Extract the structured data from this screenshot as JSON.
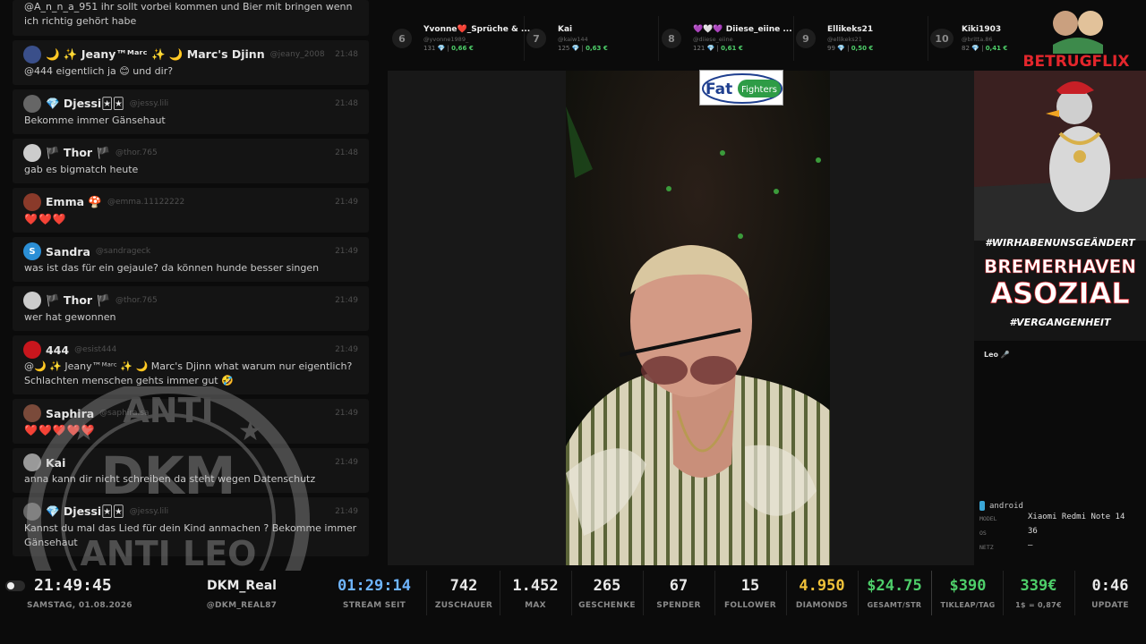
{
  "chat": {
    "messages": [
      {
        "user": "",
        "handle": "",
        "time": "",
        "text": "@A_n_n_a_951 ihr sollt vorbei kommen und Bier mit bringen wenn ich richtig gehört habe"
      },
      {
        "user": "🌙 ✨ Jeany™ᴹᵃʳᶜ ✨ 🌙 Marc's Djinn",
        "handle": "@jeany_2008",
        "time": "21:48",
        "text": "@444 eigentlich ja 😊 und dir?"
      },
      {
        "user": "💎 Djessi🃏🃏",
        "handle": "@jessy.lili",
        "time": "21:48",
        "text": "Bekomme immer Gänsehaut"
      },
      {
        "user": "🏴 Thor 🏴",
        "handle": "@thor.765",
        "time": "21:48",
        "text": "gab es bigmatch heute"
      },
      {
        "user": "Emma 🍄",
        "handle": "@emma.11122222",
        "time": "21:49",
        "text": "❤️❤️❤️"
      },
      {
        "user": "Sandra",
        "handle": "@sandrageck",
        "time": "21:49",
        "text": "was ist das für ein gejaule? da können hunde besser singen"
      },
      {
        "user": "🏴 Thor 🏴",
        "handle": "@thor.765",
        "time": "21:49",
        "text": "wer hat gewonnen"
      },
      {
        "user": "444",
        "handle": "@esist444",
        "time": "21:49",
        "text": "@🌙 ✨ Jeany™ᴹᵃʳᶜ ✨ 🌙 Marc's Djinn what warum nur eigentlich? Schlachten menschen gehts immer gut 🤣"
      },
      {
        "user": "Saphira",
        "handle": "@saphira.sa",
        "time": "21:49",
        "text": "❤️❤️❤️❤️❤️"
      },
      {
        "user": "Kai",
        "handle": "",
        "time": "21:49",
        "text": "anna kann dir nicht schreiben da steht wegen Datenschutz"
      },
      {
        "user": "💎 Djessi🃏🃏",
        "handle": "@jessy.lili",
        "time": "21:49",
        "text": "Kannst du mal das Lied für dein Kind anmachen ? Bekomme immer Gänsehaut"
      }
    ],
    "watermark": {
      "top": "ANTI",
      "middle": "DKM",
      "bottom": "ANTI LEO"
    }
  },
  "ranking": [
    {
      "rank": "6",
      "name": "Yvonne❤️_Sprüche & ...",
      "handle": "@yvonne1989_",
      "diamonds": "131",
      "money": "0,66 €"
    },
    {
      "rank": "7",
      "name": "Kai",
      "handle": "@kaiw144",
      "diamonds": "125",
      "money": "0,63 €"
    },
    {
      "rank": "8",
      "name": "💜🤍💜 Diiese_eiine ...",
      "handle": "@diiese_eiine",
      "diamonds": "121",
      "money": "0,61 €"
    },
    {
      "rank": "9",
      "name": "Ellikeks21",
      "handle": "@ellikeks21",
      "diamonds": "99",
      "money": "0,50 €"
    },
    {
      "rank": "10",
      "name": "Kiki1903",
      "handle": "@britta.86",
      "diamonds": "82",
      "money": "0,41 €"
    }
  ],
  "video": {
    "sponsor_logo": {
      "word1": "Fat",
      "word2": "Fighters"
    }
  },
  "right": {
    "brand": "BETRUGFLIX",
    "poster": {
      "hashtag_top": "#WIRHABENUNSGEÄNDERT",
      "line1": "BREMERHAVEN",
      "line2": "ASOZIAL",
      "hashtag_bottom": "#VERGANGENHEIT"
    },
    "leo_label": "Leo 🎤",
    "device": {
      "os_icon": "android-icon",
      "os_title": "android",
      "model_label": "MODEL",
      "model": "Xiaomi Redmi Note 14",
      "os_label": "OS",
      "os": "36",
      "netz_label": "NETZ",
      "netz": "—"
    }
  },
  "bottom": {
    "clock": "21:49:45",
    "date": "SAMSTAG, 01.08.2026",
    "channel_name": "DKM_Real",
    "channel_handle": "@DKM_REAL87",
    "stream_time": "01:29:14",
    "stream_time_label": "STREAM SEIT",
    "viewers": "742",
    "viewers_label": "ZUSCHAUER",
    "max": "1.452",
    "max_label": "MAX",
    "gifts": "265",
    "gifts_label": "GESCHENKE",
    "donors": "67",
    "donors_label": "SPENDER",
    "followers": "15",
    "followers_label": "FOLLOWER",
    "diamonds": "4.950",
    "diamonds_label": "DIAMONDS",
    "total": "$24.75",
    "total_label": "GESAMT/STR",
    "tikleap": "$390",
    "tikleap_label": "TIKLEAP/TAG",
    "euro": "339€",
    "euro_label": "1$ = 0,87€",
    "update": "0:46",
    "update_label": "UPDATE"
  },
  "colors": {
    "money_green": "#4ecf6a",
    "diamond_yellow": "#f0c23a",
    "clock_blue": "#6fb6ff",
    "heart_red": "#e0202a",
    "brand_red": "#e3262c"
  }
}
